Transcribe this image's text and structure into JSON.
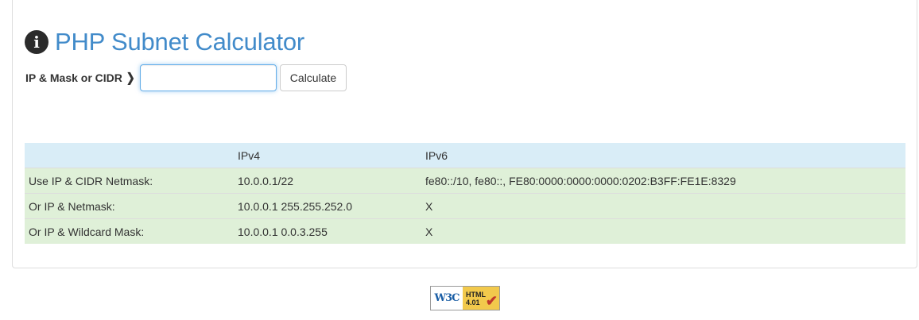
{
  "header": {
    "title": "PHP Subnet Calculator",
    "info_icon": "info-icon"
  },
  "form": {
    "label": "IP & Mask or CIDR",
    "chevron_icon": "chevron-right-icon",
    "input_value": "",
    "input_placeholder": "",
    "button_label": "Calculate"
  },
  "table": {
    "headers": [
      "",
      "IPv4",
      "IPv6"
    ],
    "rows": [
      [
        "Use IP & CIDR Netmask:",
        "10.0.0.1/22",
        "fe80::/10, fe80::, FE80:0000:0000:0000:0202:B3FF:FE1E:8329"
      ],
      [
        "Or IP & Netmask:",
        "10.0.0.1 255.255.252.0",
        "X"
      ],
      [
        "Or IP & Wildcard Mask:",
        "10.0.0.1 0.0.3.255",
        "X"
      ]
    ]
  },
  "badge": {
    "left": "W3C",
    "line1": "HTML",
    "line2": "4.01",
    "check_icon": "checkmark-icon"
  },
  "colors": {
    "title": "#428bca",
    "header_row": "#d9edf7",
    "data_row": "#dff0d8"
  }
}
